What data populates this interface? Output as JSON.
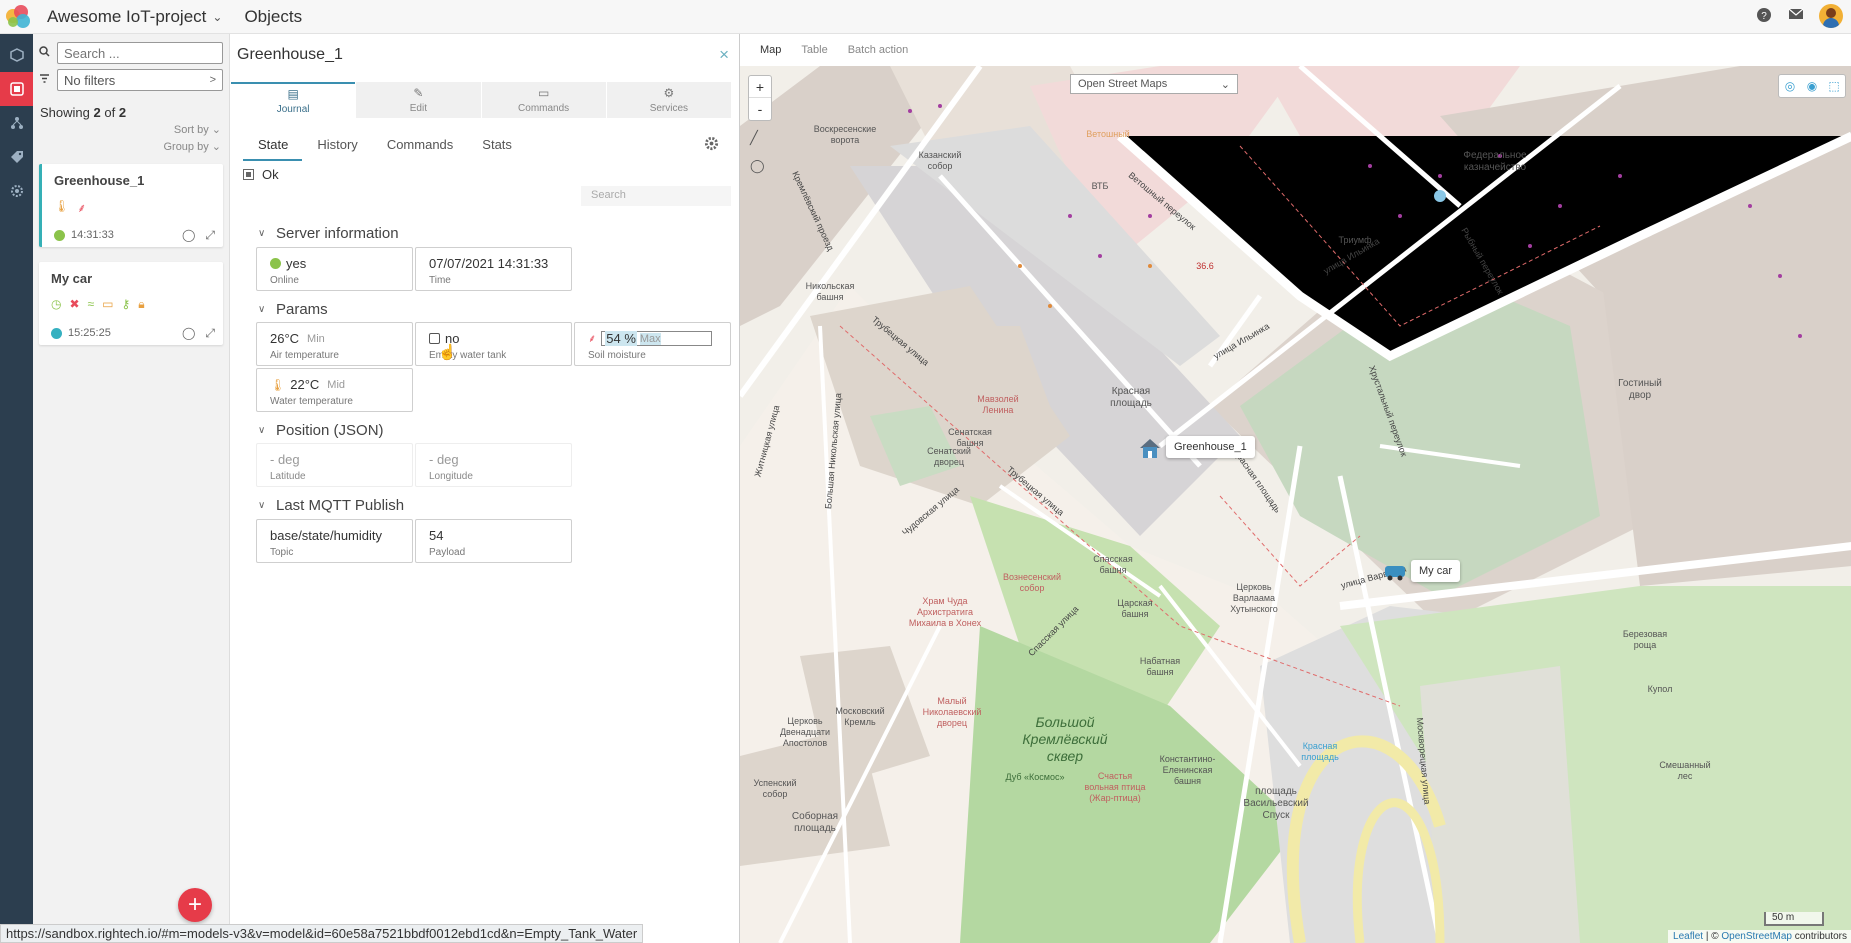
{
  "header": {
    "project_name": "Awesome IoT-project",
    "section_title": "Objects"
  },
  "list": {
    "search_placeholder": "Search ...",
    "filter_label": "No filters",
    "showing_prefix": "Showing",
    "showing_count": "2",
    "showing_of": "of",
    "showing_total": "2",
    "sort_by": "Sort by",
    "group_by": "Group by",
    "items": [
      {
        "name": "Greenhouse_1",
        "time": "14:31:33",
        "status_color": "#8bc34a"
      },
      {
        "name": "My car",
        "time": "15:25:25",
        "status_color": "#35b0c0"
      }
    ],
    "add_label": "+"
  },
  "detail": {
    "title": "Greenhouse_1",
    "close": "×",
    "main_tabs": [
      "Journal",
      "Edit",
      "Commands",
      "Services"
    ],
    "sub_tabs": [
      "State",
      "History",
      "Commands",
      "Stats"
    ],
    "ok_label": "Ok",
    "search_placeholder": "Search",
    "groups": {
      "server": "Server information",
      "params": "Params",
      "position": "Position (JSON)",
      "mqtt": "Last MQTT Publish"
    },
    "server": {
      "online_value": "yes",
      "online_label": "Online",
      "time_value": "07/07/2021 14:31:33",
      "time_label": "Time"
    },
    "params": {
      "air_value": "26°C",
      "air_tag": "Min",
      "air_label": "Air temperature",
      "tank_value": "no",
      "tank_label": "Empty water tank",
      "soil_value": "54 %",
      "soil_tag": "Max",
      "soil_label": "Soil moisture",
      "water_value": "22°C",
      "water_tag": "Mid",
      "water_label": "Water temperature"
    },
    "position": {
      "lat_value": "- deg",
      "lat_label": "Latitude",
      "lon_value": "- deg",
      "lon_label": "Longitude"
    },
    "mqtt": {
      "topic_value": "base/state/humidity",
      "topic_label": "Topic",
      "payload_value": "54",
      "payload_label": "Payload"
    }
  },
  "map": {
    "tabs": [
      "Map",
      "Table",
      "Batch action"
    ],
    "layer": "Open Street Maps",
    "zoom_in": "+",
    "zoom_out": "-",
    "markers": [
      "Greenhouse_1",
      "My car"
    ],
    "labels": {
      "krasnaya": "Красная площадь",
      "senatsky": "Сенатский дворец",
      "mavzoley": "Мавзолей Ленина",
      "kazansky": "Казанский собор",
      "voskres": "Воскресенские ворота",
      "nikolskaya": "Никольская башня",
      "senatskaya_tower": "Сенатская башня",
      "spasskaya": "Спасская башня",
      "tsarskaya": "Царская башня",
      "nabatnaya": "Набатная башня",
      "konst": "Константино-Еленинская башня",
      "vasilyevsky": "площадь Васильевский Спуск",
      "varlaam": "Церковь Варлаама Хутынского",
      "gostiny": "Гостиный двор",
      "federal": "Федеральное казначейство",
      "triumf": "Триумф",
      "vozn": "Вознесенский собор",
      "chudo": "Храм Чуда Архистратига Михаила в Хонех",
      "maly": "Малый Николаевский дворец",
      "skver": "Большой Кремлёвский сквер",
      "moskovsky": "Московский Кремль",
      "dvenadtsat": "Церковь Двенадцати Апостолов",
      "uspensky": "Успенский собор",
      "soborna": "Соборная площадь",
      "dub": "Дуб «Космос»",
      "schastie": "Счастья вольная птица (Жар-птица)",
      "berez": "Березовая роща",
      "kupol": "Купол",
      "smesh": "Смешанный лес",
      "vtb": "ВТБ",
      "vetoshny": "Ветошный",
      "price": "36.6",
      "krasnaya_station": "Красная площадь"
    },
    "streets": {
      "vetoshny_per": "Ветошный переулок",
      "ilyinka": "улица Ильинка",
      "ilyinka2": "улица Ильинка",
      "rybny": "Рыбный переулок",
      "khrustal": "Хрустальный переулок",
      "trubetskaya": "Трубецкая улица",
      "trubetskaya2": "Трубецкая улица",
      "kremlevsky": "Кремлёвский проезд",
      "chudovskaya": "Чудовская улица",
      "spasskaya_ul": "Спасская улица",
      "b_nikolskaya": "Большая Никольская улица",
      "zhitnitskaya": "Житницкая улица",
      "krasnaya_pl": "Красная площадь",
      "varvarka": "улица Варварка",
      "moskvoretskaya": "Москворецкая улица"
    },
    "scale": "50 m",
    "attribution_leaflet": "Leaflet",
    "attribution_sep": " | © ",
    "attribution_osm": "OpenStreetMap",
    "attribution_tail": " contributors"
  },
  "status_url": "https://sandbox.rightech.io/#m=models-v3&v=model&id=60e58a7521bbdf0012ebd1cd&n=Empty_Tank_Water"
}
